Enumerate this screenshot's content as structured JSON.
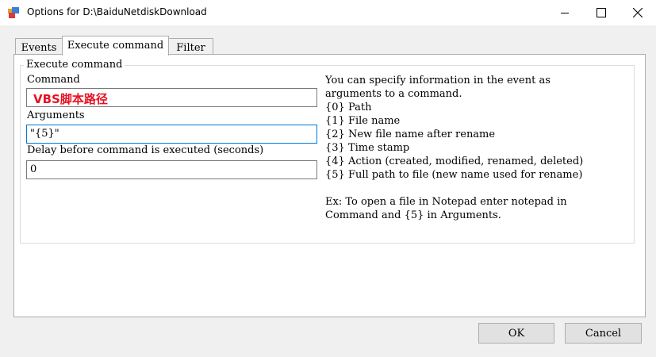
{
  "window": {
    "title": "Options for D:\\BaiduNetdiskDownload"
  },
  "tabs": [
    "Events",
    "Execute command",
    "Filter"
  ],
  "group": {
    "legend": "Execute command"
  },
  "fields": {
    "command_label": "Command",
    "command_value": "VBS脚本路径",
    "arguments_label": "Arguments",
    "arguments_value": "\"{5}\"",
    "delay_label": "Delay before command is executed (seconds)",
    "delay_value": "0"
  },
  "info": {
    "intro_1": "You can specify information in the event as",
    "intro_2": "arguments to a command.",
    "params": [
      "{0} Path",
      "{1} File name",
      "{2} New file name after rename",
      "{3} Time stamp",
      "{4} Action (created, modified, renamed, deleted)",
      "{5} Full path to file (new name used for rename)"
    ],
    "example_1": "Ex: To open a file in Notepad enter notepad in",
    "example_2": "Command and {5} in Arguments."
  },
  "buttons": {
    "ok": "OK",
    "cancel": "Cancel"
  },
  "icons": [
    "app-icon",
    "minimize-icon",
    "maximize-icon",
    "close-icon"
  ],
  "colors": {
    "command_text": "#e81123",
    "focus_border": "#0078d7"
  }
}
